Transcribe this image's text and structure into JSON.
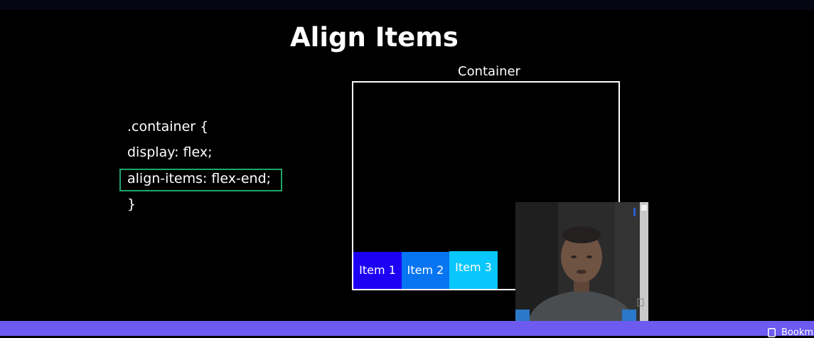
{
  "slide": {
    "title": "Align Items",
    "code_lines": [
      ".container {",
      "display: flex;",
      "align-items: flex-end;",
      "}"
    ],
    "container_label": "Container",
    "items": [
      "Item 1",
      "Item 2",
      "Item 3"
    ],
    "item_colors": [
      "#1d01f4",
      "#0775f1",
      "#09c7fb"
    ],
    "highlight_color": "#1ea46d"
  },
  "bottom_bar": {
    "bookmark_label": "Bookm",
    "bar_color": "#6c5af1"
  }
}
